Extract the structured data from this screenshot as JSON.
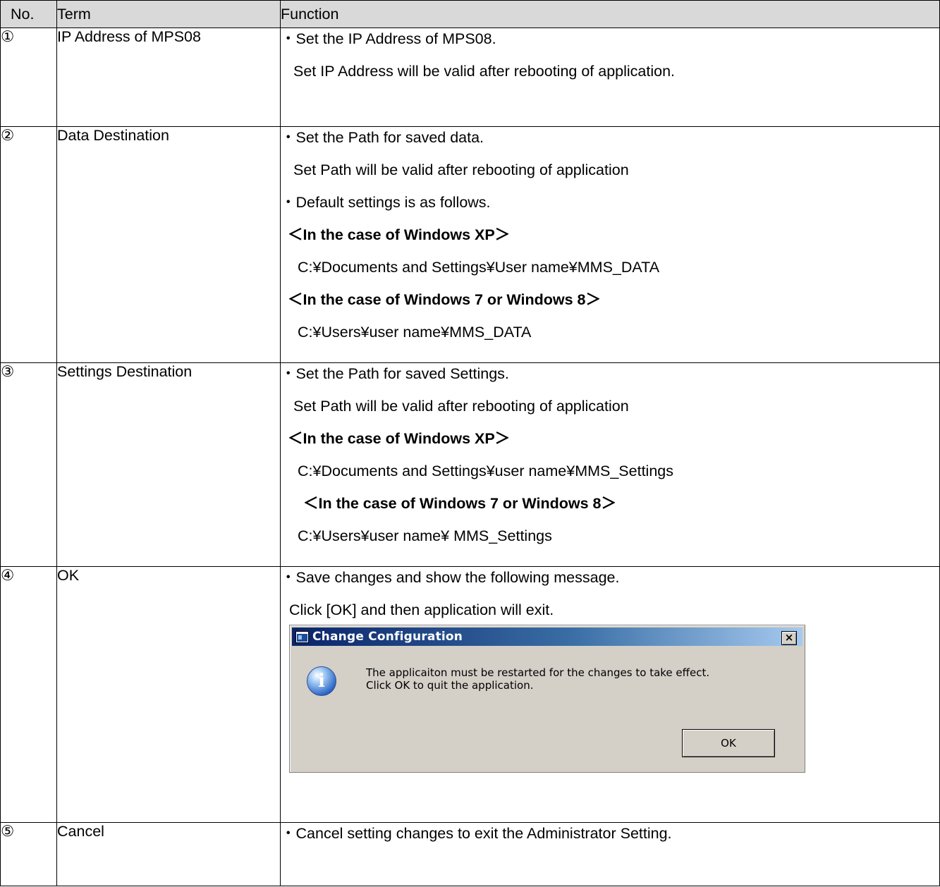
{
  "headers": {
    "no": "No.",
    "term": "Term",
    "function": "Function"
  },
  "rows": [
    {
      "no": "①",
      "term": "IP Address of MPS08",
      "lines": [
        "・Set the IP Address of MPS08.",
        "Set IP Address will be valid after rebooting of application."
      ]
    },
    {
      "no": "②",
      "term": "Data Destination",
      "lines": [
        "・Set the Path for saved data.",
        "Set Path will be valid after rebooting of application",
        "・Default settings is as follows.",
        "＜In the case of Windows XP＞",
        "C:¥Documents and Settings¥User name¥MMS_DATA",
        "＜In the case of Windows 7 or Windows 8＞",
        "C:¥Users¥user name¥MMS_DATA"
      ]
    },
    {
      "no": "③",
      "term": "Settings Destination",
      "lines": [
        "・Set the Path for saved Settings.",
        "Set Path will be valid after rebooting of application",
        "＜In the case of Windows XP＞",
        "C:¥Documents and Settings¥user name¥MMS_Settings",
        "＜In the case of Windows 7 or Windows 8＞",
        "C:¥Users¥user name¥ MMS_Settings"
      ]
    },
    {
      "no": "④",
      "term": "OK",
      "lines": [
        "・Save changes and show the following message.",
        "Click [OK] and then application will exit."
      ],
      "dialog": {
        "title": "Change Configuration",
        "close": "×",
        "message_line1": "The applicaiton must be restarted for the changes to take effect.",
        "message_line2": "Click OK to quit the application.",
        "ok_label": "OK",
        "icon": "info-icon"
      }
    },
    {
      "no": "⑤",
      "term": "Cancel",
      "lines": [
        "・Cancel setting changes to exit the Administrator Setting."
      ]
    }
  ]
}
